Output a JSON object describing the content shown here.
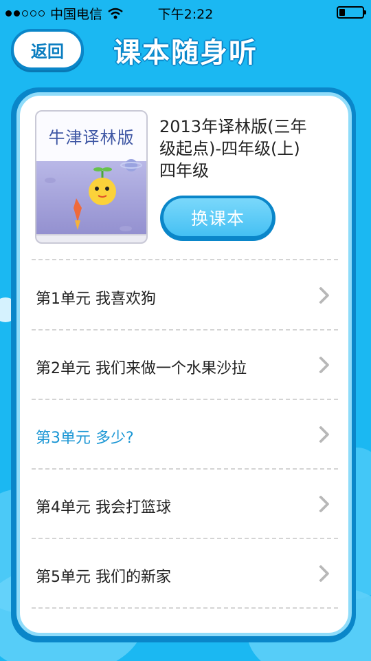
{
  "status_bar": {
    "carrier": "中国电信",
    "time": "下午2:22"
  },
  "header": {
    "back_label": "返回",
    "title": "课本随身听"
  },
  "book": {
    "cover_title": "牛津译林版",
    "info_lines": [
      "2013年译林版(三年",
      "级起点)-四年级(上)",
      "四年级"
    ],
    "change_label": "换课本"
  },
  "units": [
    {
      "label": "第1单元 我喜欢狗",
      "active": false
    },
    {
      "label": "第2单元 我们来做一个水果沙拉",
      "active": false
    },
    {
      "label": "第3单元 多少?",
      "active": true
    },
    {
      "label": "第4单元 我会打篮球",
      "active": false
    },
    {
      "label": "第5单元 我们的新家",
      "active": false
    }
  ],
  "colors": {
    "background": "#1bb8f2",
    "card_border": "#0a86c9",
    "active_text": "#1a96d4"
  }
}
